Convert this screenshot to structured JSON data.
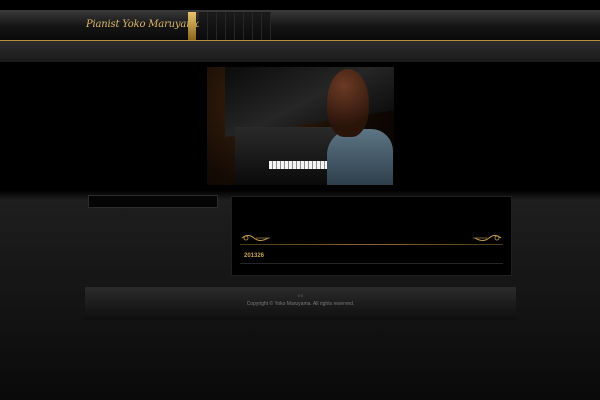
{
  "header": {
    "logo_text": "Pianist Yoko Maruyama Website",
    "nav_items": [
      "",
      "",
      "",
      "",
      "",
      "",
      "",
      ""
    ]
  },
  "hero": {
    "image_icon": "pianist-photo"
  },
  "main": {
    "post_title": "201326"
  },
  "footer": {
    "small_text": "© ©",
    "copyright": "Copyright © Yoko Maruyama. All rights reserved."
  },
  "colors": {
    "gold": "#c8a14e",
    "background": "#000000"
  }
}
